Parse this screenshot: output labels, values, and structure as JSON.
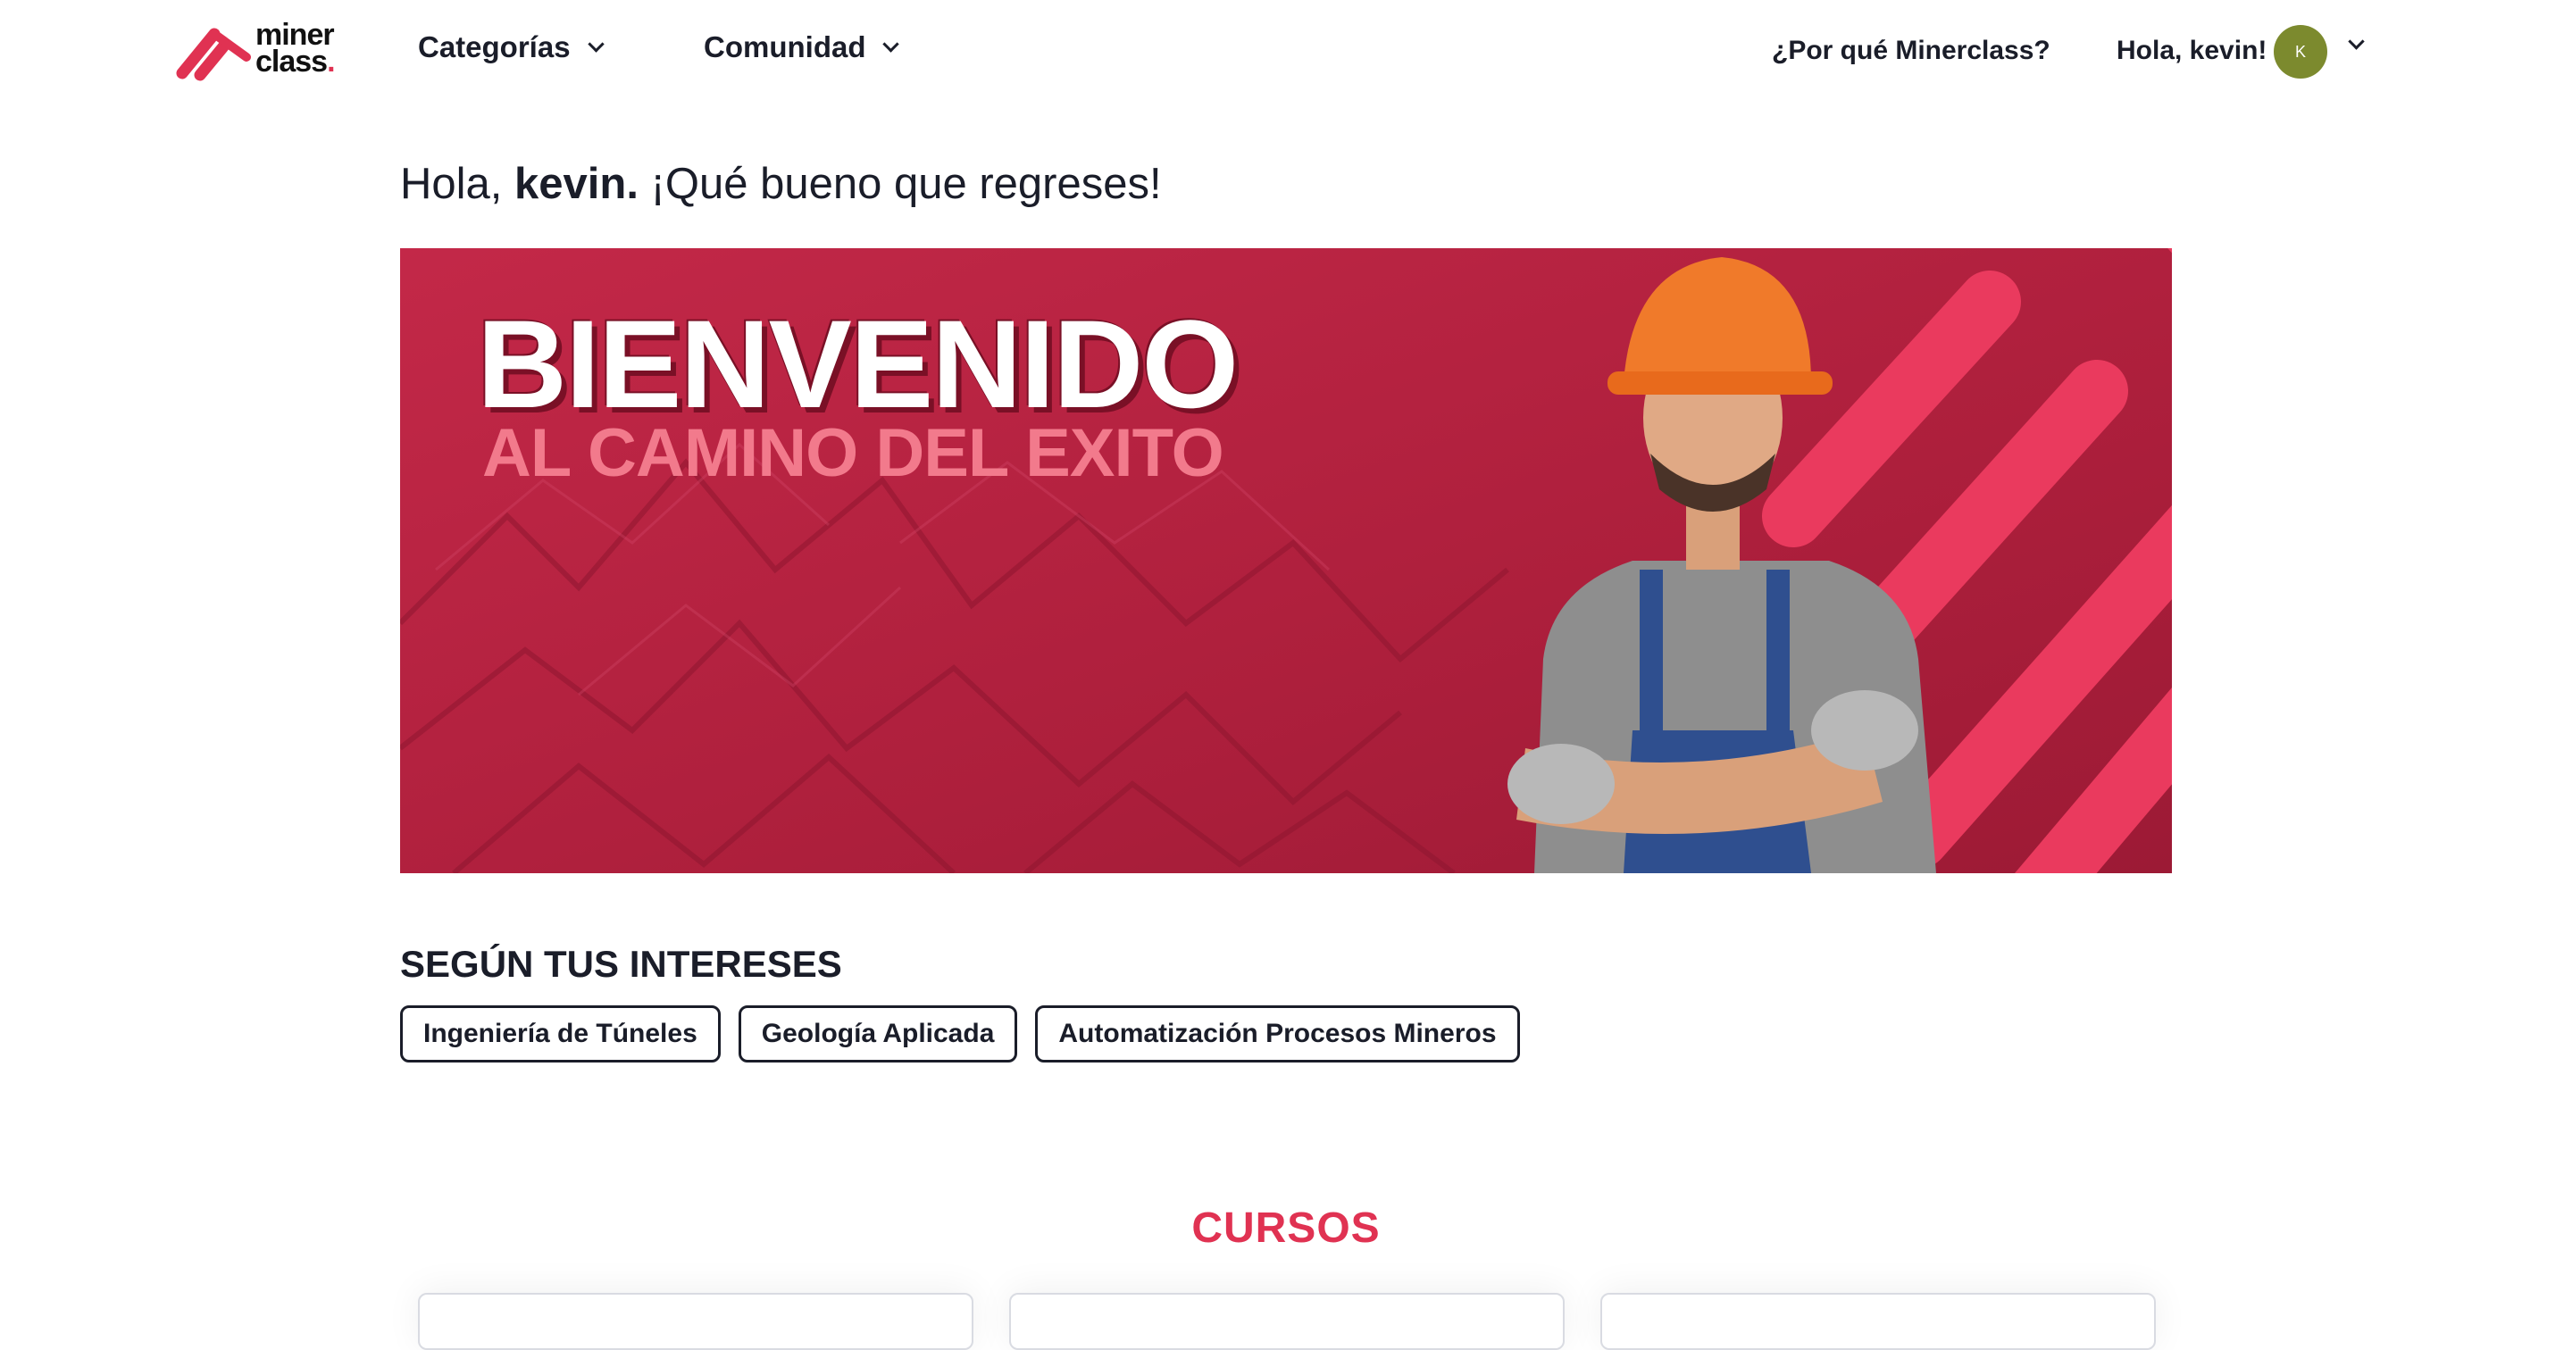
{
  "header": {
    "logo_line1": "miner",
    "logo_line2": "class",
    "logo_dot": ".",
    "nav": [
      {
        "label": "Categorías"
      },
      {
        "label": "Comunidad"
      }
    ],
    "why_link": "¿Por qué Minerclass?",
    "greeting": "Hola, kevin!",
    "avatar_initial": "K"
  },
  "welcome": {
    "prefix": "Hola, ",
    "name": "kevin.",
    "suffix": " ¡Qué bueno que regreses!"
  },
  "banner": {
    "title": "BIENVENIDO",
    "subtitle": "AL CAMINO DEL EXITO"
  },
  "interests": {
    "title": "SEGÚN TUS INTERESES",
    "chips": [
      "Ingeniería de Túneles",
      "Geología Aplicada",
      "Automatización Procesos Mineros"
    ]
  },
  "courses": {
    "title": "CURSOS"
  },
  "colors": {
    "brand": "#e03252",
    "banner_bg": "#b7213e",
    "avatar_bg": "#7c8a2e",
    "text": "#1a1d29"
  }
}
